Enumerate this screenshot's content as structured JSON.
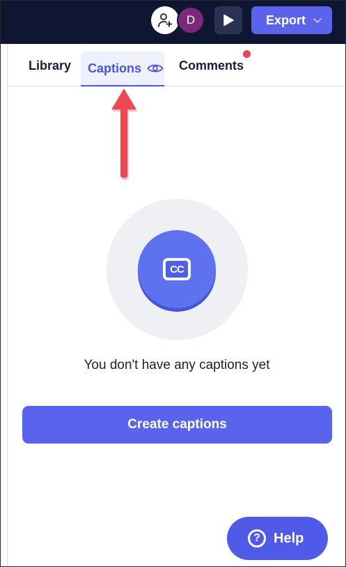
{
  "topbar": {
    "avatar_initial": "D",
    "export_label": "Export"
  },
  "tabs": [
    {
      "label": "Library",
      "active": false
    },
    {
      "label": "Captions",
      "active": true
    },
    {
      "label": "Comments",
      "active": false,
      "has_notification": true
    }
  ],
  "empty_state": {
    "icon_text": "CC",
    "message": "You don't have any captions yet"
  },
  "actions": {
    "create_label": "Create captions"
  },
  "help": {
    "label": "Help",
    "icon_text": "?"
  },
  "colors": {
    "topbar_bg": "#0f1631",
    "accent": "#5a63eb",
    "active_tab_text": "#4a55dd",
    "notification": "#ef3e57",
    "annotation_arrow": "#ef4850"
  }
}
